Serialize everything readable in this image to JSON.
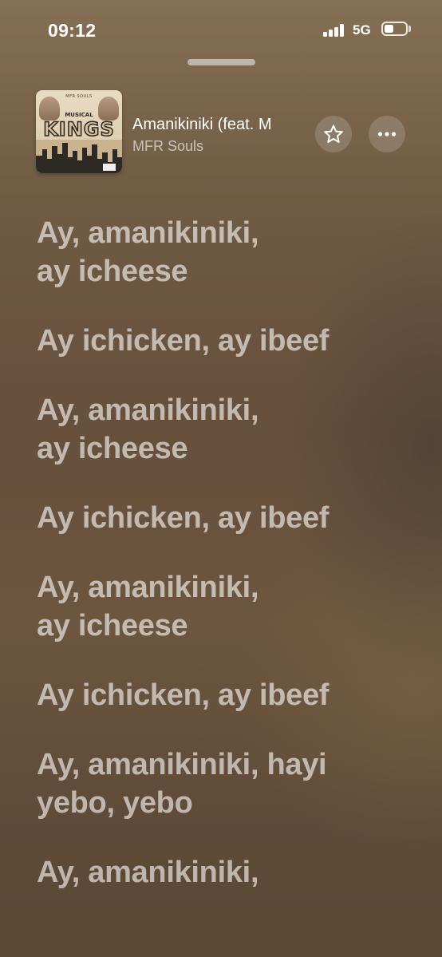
{
  "status_bar": {
    "time": "09:12",
    "network": "5G",
    "battery_level": 0.45,
    "icons": [
      "signal-icon",
      "battery-icon"
    ]
  },
  "now_playing": {
    "title": "Amanikiniki (feat. M",
    "artist": "MFR Souls",
    "album_art": {
      "top_text": "MFR SOULS",
      "subtitle_text": "MUSICAL",
      "main_text": "KINGS"
    },
    "buttons": [
      "favorite-star-icon",
      "more-options-icon"
    ]
  },
  "lyrics": [
    "Ay, amanikiniki,\nay icheese",
    "Ay ichicken, ay ibeef",
    "Ay, amanikiniki,\nay icheese",
    "Ay ichicken, ay ibeef",
    "Ay, amanikiniki,\nay icheese",
    "Ay ichicken, ay ibeef",
    "Ay, amanikiniki, hayi\nyebo, yebo",
    "Ay, amanikiniki,"
  ]
}
